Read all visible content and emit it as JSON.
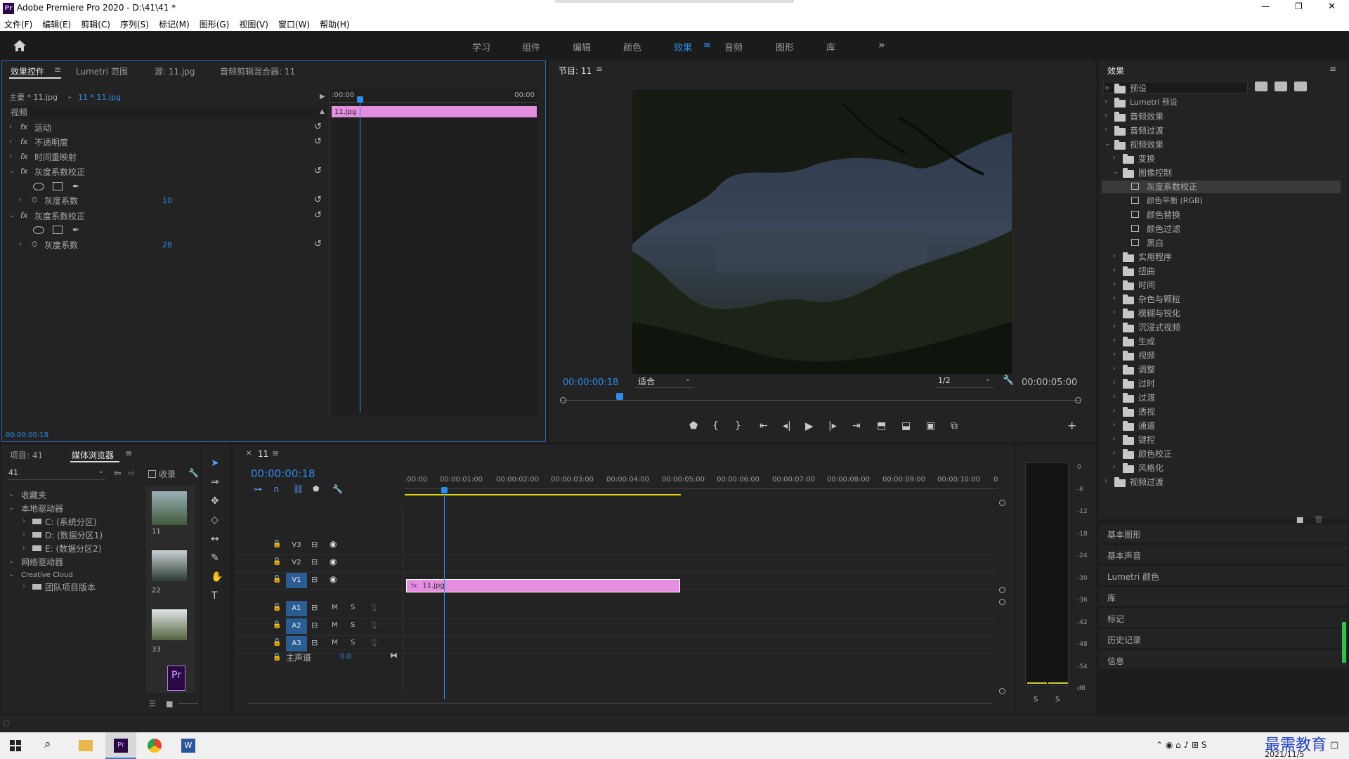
{
  "app": {
    "title": "Adobe Premiere Pro 2020 - D:\\41\\41 *",
    "logo": "Pr",
    "window_controls": [
      "—",
      "❐",
      "✕"
    ]
  },
  "menu": [
    "文件(F)",
    "编辑(E)",
    "剪辑(C)",
    "序列(S)",
    "标记(M)",
    "图形(G)",
    "视图(V)",
    "窗口(W)",
    "帮助(H)"
  ],
  "workspaces": {
    "tabs": [
      "学习",
      "组件",
      "编辑",
      "颜色",
      "效果",
      "音频",
      "图形",
      "库"
    ],
    "active": "效果",
    "more": "»"
  },
  "effect_controls": {
    "tabs": [
      "效果控件",
      "Lumetri 范围",
      "源: 11.jpg",
      "音频剪辑混合器: 11"
    ],
    "master_clip": "主要 * 11.jpg",
    "seq_clip": "11 * 11.jpg",
    "section": "视频",
    "rows": [
      {
        "label": "运动",
        "fx": "fx"
      },
      {
        "label": "不透明度",
        "fx": "fx"
      },
      {
        "label": "时间重映射",
        "fx": "fx"
      },
      {
        "label": "灰度系数校正",
        "fx": "fx"
      },
      {
        "label": "灰度系数",
        "value": "10"
      },
      {
        "label": "灰度系数校正",
        "fx": "fx"
      },
      {
        "label": "灰度系数",
        "value": "28"
      }
    ],
    "mini_time_start": ":00:00",
    "mini_time_end": "00:00",
    "clip_label": "11.jpg",
    "timecode": "00:00:00:18"
  },
  "program": {
    "title": "节目: 11",
    "timecode": "00:00:00:18",
    "fit": "适合",
    "resolution": "1/2",
    "duration": "00:00:05:00"
  },
  "project": {
    "tabs": [
      "项目: 41",
      "媒体浏览器"
    ],
    "path_value": "41",
    "favorites_label": "收录",
    "tree": [
      {
        "label": "收藏夹",
        "level": 0
      },
      {
        "label": "本地驱动器",
        "level": 0
      },
      {
        "label": "C: (系统分区)",
        "level": 1
      },
      {
        "label": "D: (数据分区1)",
        "level": 1
      },
      {
        "label": "E: (数据分区2)",
        "level": 1
      },
      {
        "label": "网络驱动器",
        "level": 0
      },
      {
        "label": "Creative Cloud",
        "level": 0
      },
      {
        "label": "团队项目版本",
        "level": 1
      }
    ],
    "thumbs": [
      "11",
      "22",
      "33"
    ]
  },
  "timeline": {
    "title": "11",
    "timecode": "00:00:00:18",
    "ruler": [
      ":00:00",
      "00:00:01:00",
      "00:00:02:00",
      "00:00:03:00",
      "00:00:04:00",
      "00:00:05:00",
      "00:00:06:00",
      "00:00:07:00",
      "00:00:08:00",
      "00:00:09:00",
      "00:00:10:00",
      "0"
    ],
    "video_tracks": [
      "V3",
      "V2",
      "V1"
    ],
    "audio_tracks": [
      "A1",
      "A2",
      "A3"
    ],
    "master": "主声道",
    "master_value": "0.0",
    "clip_label": "11.jpg",
    "mute": "M",
    "solo": "S"
  },
  "audio_meter": {
    "scale": [
      "0",
      "-6",
      "-12",
      "-18",
      "-24",
      "-30",
      "-36",
      "-42",
      "-48",
      "-54",
      "dB"
    ],
    "solo": [
      "S",
      "S"
    ]
  },
  "effects_panel": {
    "title": "效果",
    "tree": [
      {
        "label": "预设",
        "level": 0,
        "open": false
      },
      {
        "label": "Lumetri 预设",
        "level": 0,
        "open": false
      },
      {
        "label": "音频效果",
        "level": 0,
        "open": false
      },
      {
        "label": "音频过渡",
        "level": 0,
        "open": false
      },
      {
        "label": "视频效果",
        "level": 0,
        "open": true
      },
      {
        "label": "变换",
        "level": 1,
        "open": false
      },
      {
        "label": "图像控制",
        "level": 1,
        "open": true
      },
      {
        "label": "灰度系数校正",
        "level": 2,
        "selected": true
      },
      {
        "label": "颜色平衡 (RGB)",
        "level": 2
      },
      {
        "label": "颜色替换",
        "level": 2
      },
      {
        "label": "颜色过滤",
        "level": 2
      },
      {
        "label": "黑白",
        "level": 2
      },
      {
        "label": "实用程序",
        "level": 1
      },
      {
        "label": "扭曲",
        "level": 1
      },
      {
        "label": "时间",
        "level": 1
      },
      {
        "label": "杂色与颗粒",
        "level": 1
      },
      {
        "label": "模糊与锐化",
        "level": 1
      },
      {
        "label": "沉浸式视频",
        "level": 1
      },
      {
        "label": "生成",
        "level": 1
      },
      {
        "label": "视频",
        "level": 1
      },
      {
        "label": "调整",
        "level": 1
      },
      {
        "label": "过时",
        "level": 1
      },
      {
        "label": "过渡",
        "level": 1
      },
      {
        "label": "透视",
        "level": 1
      },
      {
        "label": "通道",
        "level": 1
      },
      {
        "label": "键控",
        "level": 1
      },
      {
        "label": "颜色校正",
        "level": 1
      },
      {
        "label": "风格化",
        "level": 1
      },
      {
        "label": "视频过渡",
        "level": 0
      }
    ],
    "collapsed_panels": [
      "基本图形",
      "基本声音",
      "Lumetri 颜色",
      "库",
      "标记",
      "历史记录",
      "信息"
    ]
  },
  "taskbar": {
    "date": "2021/11/5",
    "watermark": "最需教育"
  },
  "colors": {
    "accent": "#2d8ceb",
    "clip": "#e58ee0",
    "bg": "#232323"
  }
}
